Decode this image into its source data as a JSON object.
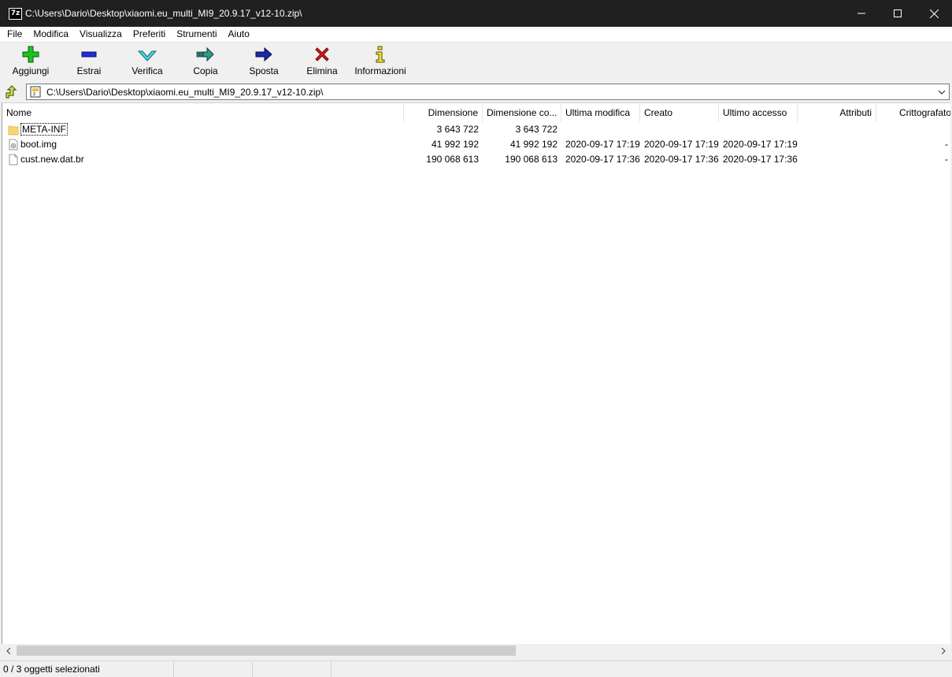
{
  "window": {
    "app_icon_text": "7z",
    "title": "C:\\Users\\Dario\\Desktop\\xiaomi.eu_multi_MI9_20.9.17_v12-10.zip\\"
  },
  "menu": [
    "File",
    "Modifica",
    "Visualizza",
    "Preferiti",
    "Strumenti",
    "Aiuto"
  ],
  "toolbar": {
    "add": "Aggiungi",
    "extract": "Estrai",
    "test": "Verifica",
    "copy": "Copia",
    "move": "Sposta",
    "delete": "Elimina",
    "info": "Informazioni"
  },
  "address": {
    "path": "C:\\Users\\Dario\\Desktop\\xiaomi.eu_multi_MI9_20.9.17_v12-10.zip\\"
  },
  "columns": {
    "name": "Nome",
    "size": "Dimensione",
    "packed": "Dimensione co...",
    "modified": "Ultima modifica",
    "created": "Creato",
    "accessed": "Ultimo accesso",
    "attributes": "Attributi",
    "encrypted": "Crittografato"
  },
  "files": [
    {
      "name": "META-INF",
      "type": "folder",
      "size": "3 643 722",
      "packed": "3 643 722",
      "modified": "",
      "created": "",
      "accessed": "",
      "encrypted": ""
    },
    {
      "name": "boot.img",
      "type": "image",
      "size": "41 992 192",
      "packed": "41 992 192",
      "modified": "2020-09-17 17:19",
      "created": "2020-09-17 17:19",
      "accessed": "2020-09-17 17:19",
      "encrypted": "-"
    },
    {
      "name": "cust.new.dat.br",
      "type": "file",
      "size": "190 068 613",
      "packed": "190 068 613",
      "modified": "2020-09-17 17:36",
      "created": "2020-09-17 17:36",
      "accessed": "2020-09-17 17:36",
      "encrypted": "-"
    }
  ],
  "status": {
    "selection": "0 / 3 oggetti selezionati"
  },
  "icons": {
    "add": "green-plus-icon",
    "extract": "blue-minus-icon",
    "test": "cyan-check-icon",
    "copy": "teal-arrow-icon",
    "move": "navy-arrow-icon",
    "delete": "red-x-icon",
    "info": "yellow-info-icon"
  }
}
